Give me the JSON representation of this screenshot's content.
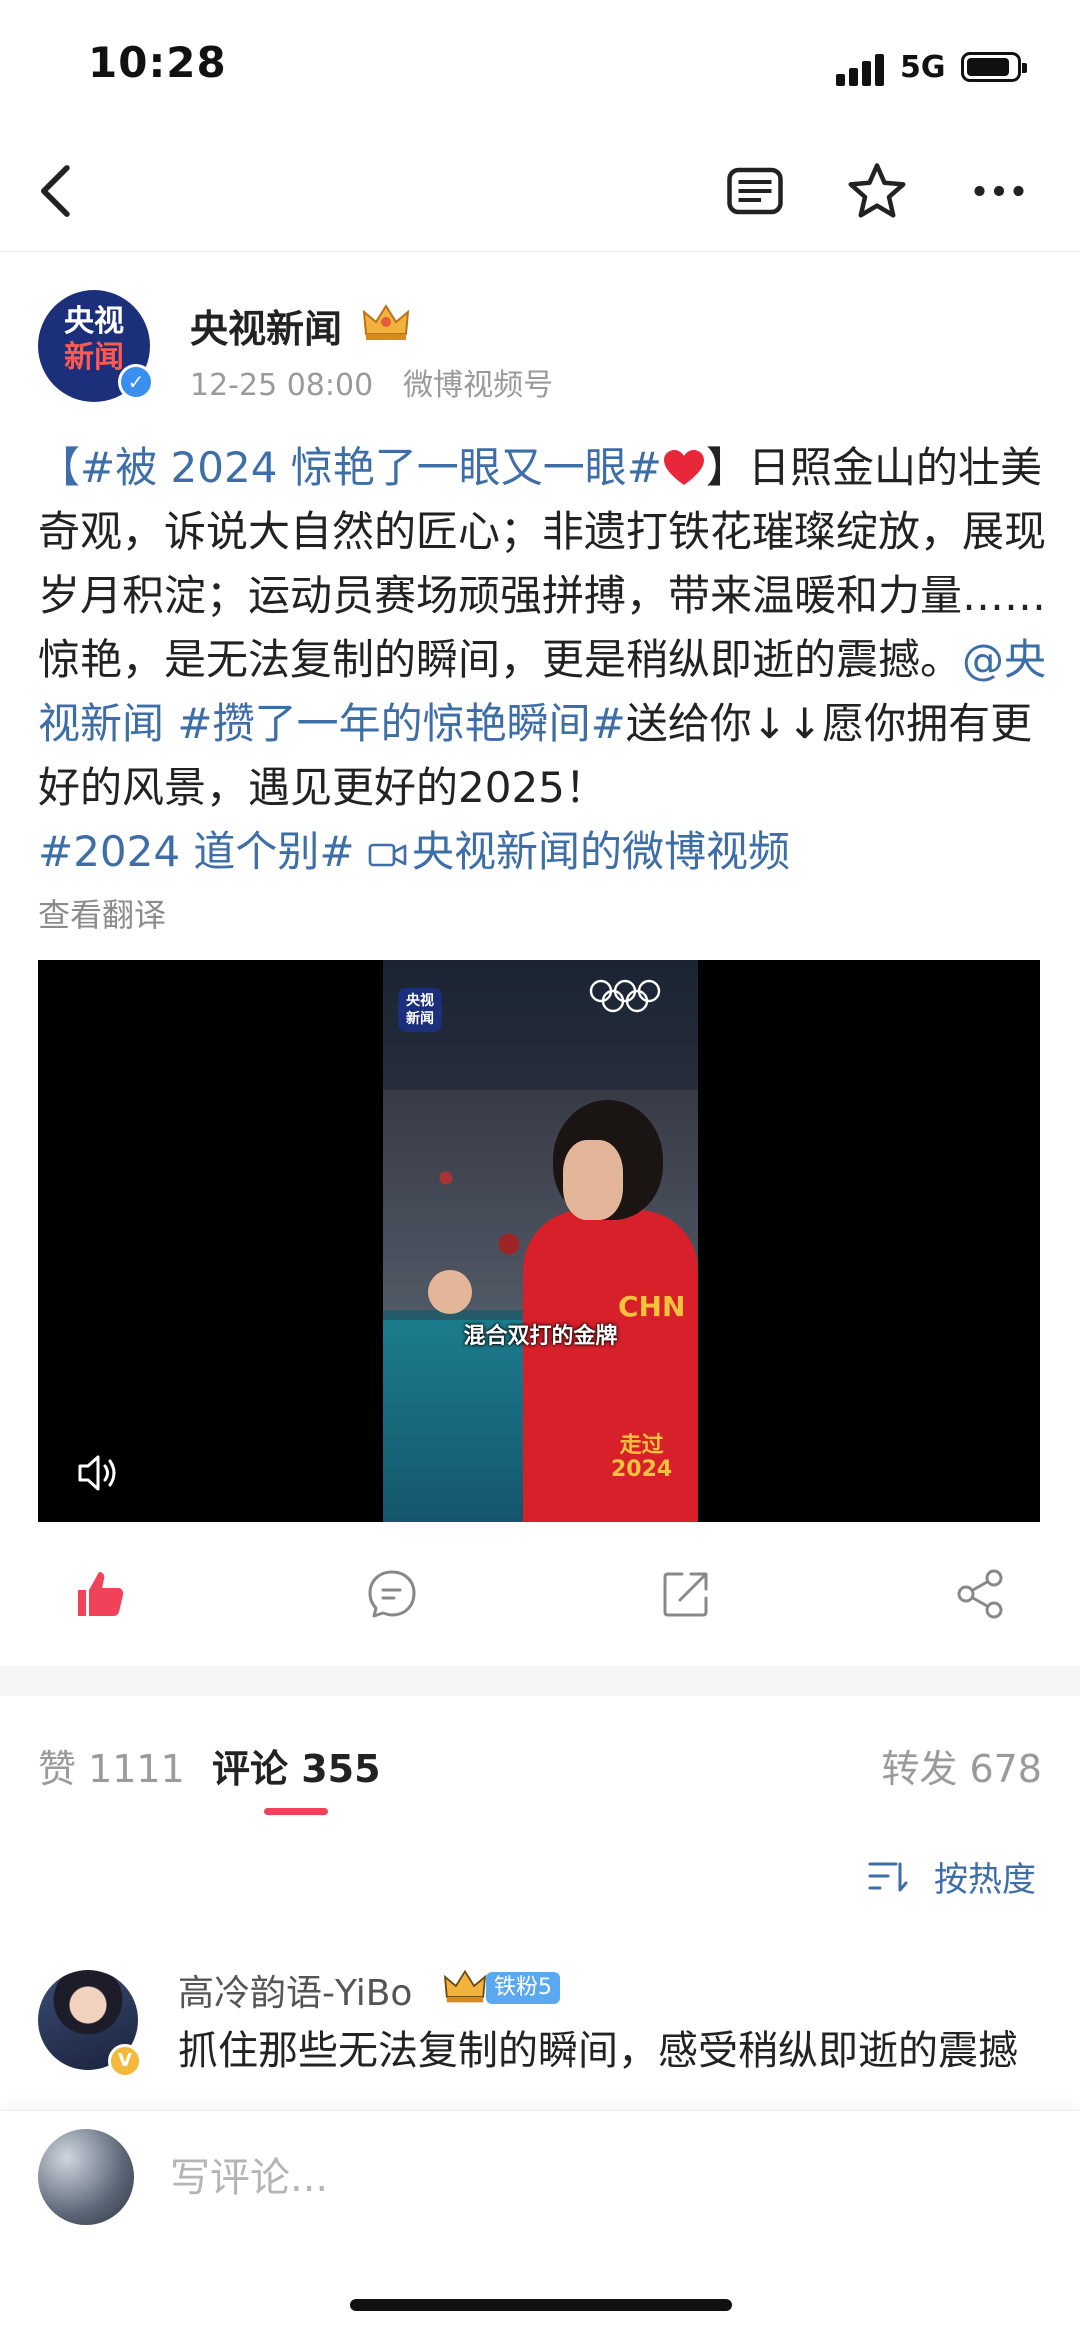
{
  "status_bar": {
    "time": "10:28",
    "network": "5G"
  },
  "post": {
    "author": "央视新闻",
    "date": "12-25 08:00",
    "source": "微博视频号",
    "avatar_text_line1": "央视",
    "avatar_text_line2": "新闻",
    "body": {
      "open_bracket": "【",
      "tag1": "#被 2024 惊艳了一眼又一眼#",
      "text1": "】日照金山的壮美奇观，诉说大自然的匠心；非遗打铁花璀璨绽放，展现岁月积淀；运动员赛场顽强拼搏，带来温暖和力量……惊艳，是无法复制的瞬间，更是稍纵即逝的震撼。",
      "mention": "@央视新闻",
      "tag2": "#攒了一年的惊艳瞬间#",
      "text2": "送给你↓↓愿你拥有更好的风景，遇见更好的2025！",
      "tag3": "#2024 道个别#",
      "video_link": "央视新闻的微博视频"
    },
    "translate": "查看翻译"
  },
  "video": {
    "caption": "混合双打的金牌",
    "logo_line1": "央视",
    "logo_line2": "新闻",
    "badge_line1": "走过",
    "badge_line2": "2024",
    "shirt_text": "CHN"
  },
  "tabs": {
    "likes": "赞 1111",
    "comments": "评论 355",
    "reposts": "转发 678"
  },
  "sort_label": "按热度",
  "comment": {
    "user": "高冷韵语-YiBo",
    "fan_badge": "铁粉5",
    "text": "抓住那些无法复制的瞬间，感受稍纵即逝的震撼"
  },
  "input_placeholder": "写评论...",
  "colors": {
    "link": "#3e6ea8",
    "accent": "#f0435a",
    "like": "#f0435a"
  },
  "icons": [
    "back-icon",
    "reader-icon",
    "star-icon",
    "more-icon",
    "like-icon",
    "comment-icon",
    "share-icon",
    "forward-icon",
    "volume-icon",
    "sort-icon"
  ]
}
